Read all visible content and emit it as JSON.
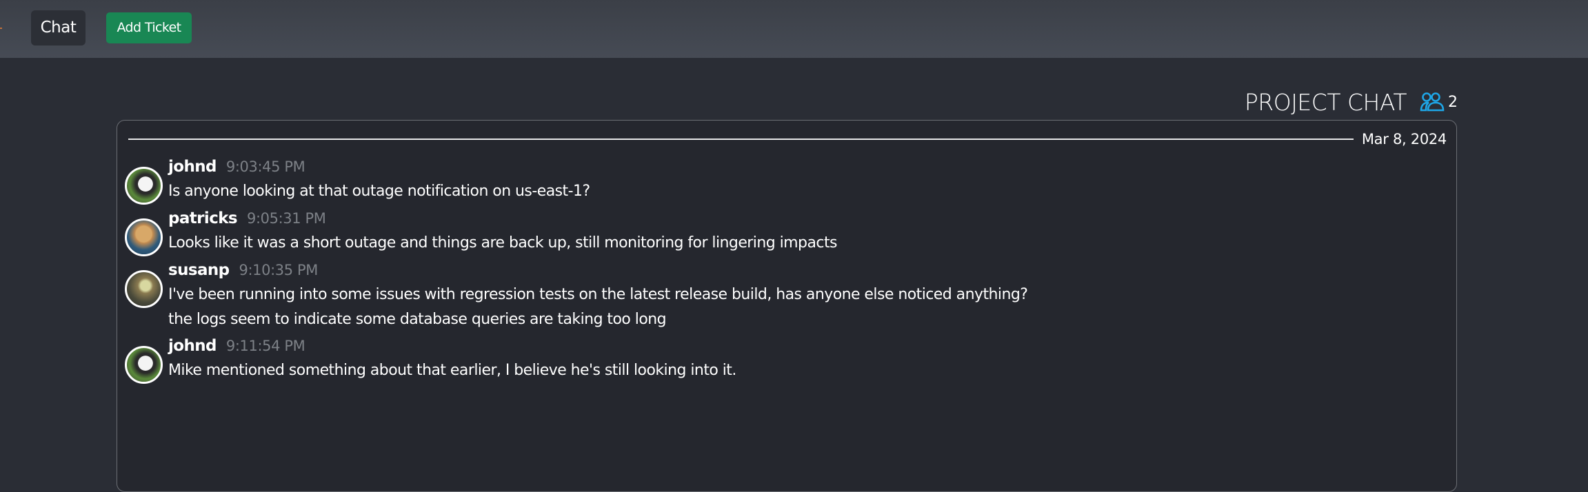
{
  "topbar": {
    "chat_label": "Chat",
    "add_ticket_label": "Add Ticket",
    "add_ticket_color": "#198754"
  },
  "chat": {
    "title": "PROJECT CHAT",
    "members_icon": "people-icon",
    "members_count": "2",
    "accent_color": "#1ea7e8",
    "date_divider": "Mar 8, 2024",
    "messages": [
      {
        "user": "johnd",
        "avatar": "panda",
        "time": "9:03:45 PM",
        "lines": [
          "Is anyone looking at that outage notification on us-east-1?"
        ]
      },
      {
        "user": "patricks",
        "avatar": "dog",
        "time": "9:05:31 PM",
        "lines": [
          "Looks like it was a short outage and things are back up, still monitoring for lingering impacts"
        ]
      },
      {
        "user": "susanp",
        "avatar": "bird",
        "time": "9:10:35 PM",
        "lines": [
          "I've been running into some issues with regression tests on the latest release build, has anyone else noticed anything?",
          "the logs seem to indicate some database queries are taking too long"
        ]
      },
      {
        "user": "johnd",
        "avatar": "panda",
        "time": "9:11:54 PM",
        "lines": [
          "Mike mentioned something about that earlier, I believe he's still looking into it."
        ]
      }
    ]
  }
}
